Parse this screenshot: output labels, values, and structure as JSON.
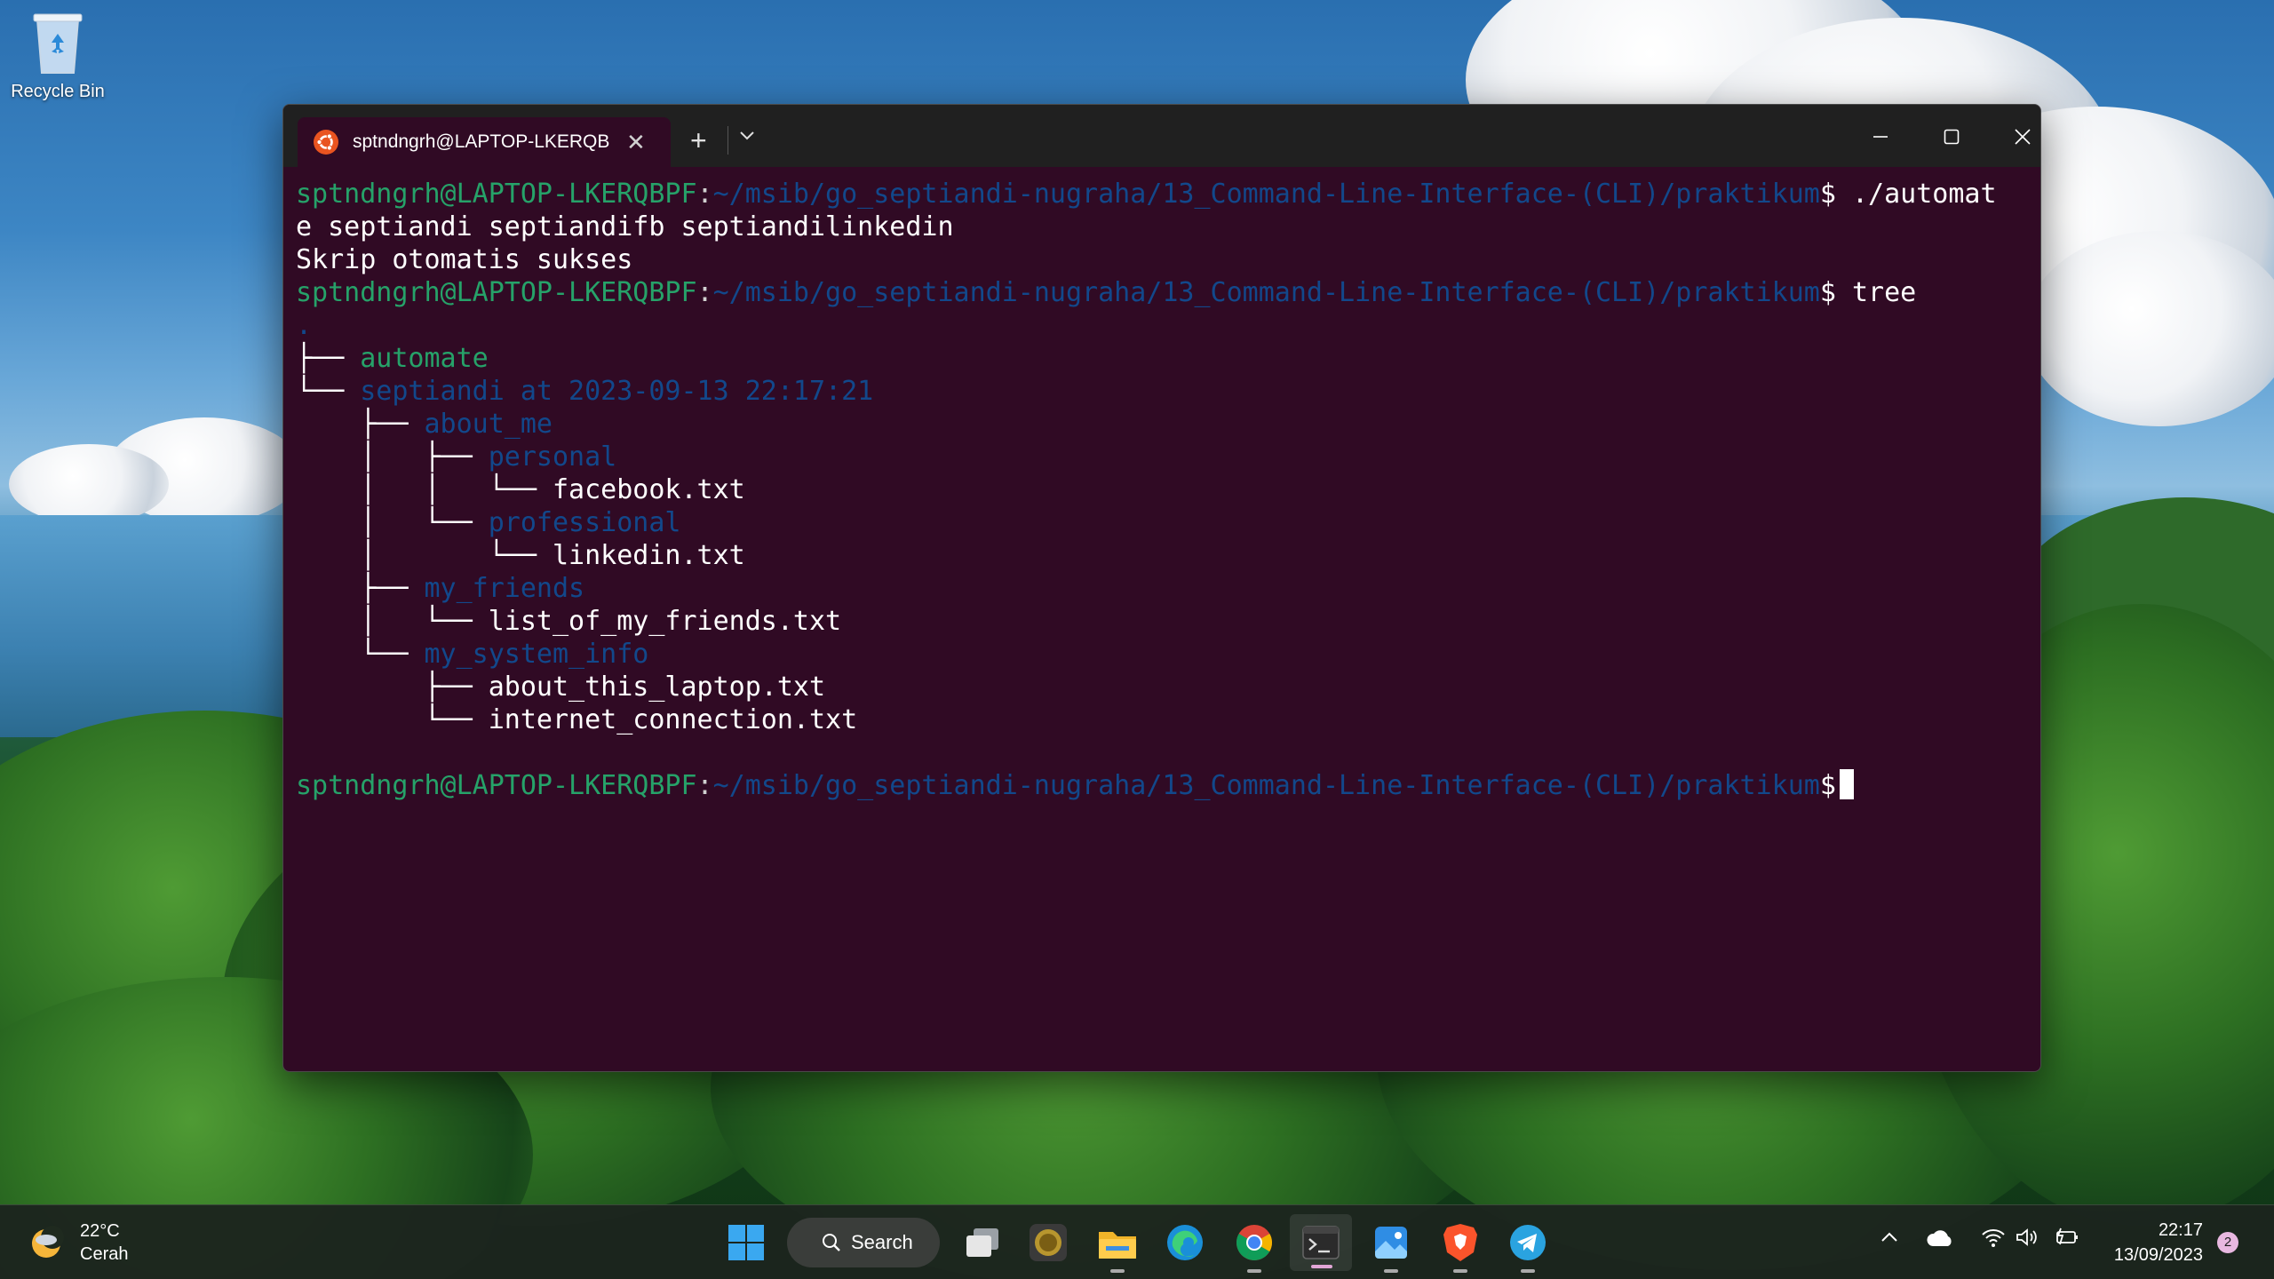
{
  "desktop": {
    "recycle_bin_label": "Recycle Bin"
  },
  "terminal": {
    "tab_title": "sptndngrh@LAPTOP-LKERQBPF: ~",
    "prompt_user": "sptndngrh@LAPTOP-LKERQBPF",
    "prompt_colon": ":",
    "prompt_path": "~/msib/go_septiandi-nugraha/13_Command-Line-Interface-(CLI)/praktikum",
    "prompt_dollar": "$",
    "cmd1_part1": " ./automat",
    "cmd1_part2": "e septiandi septiandifb septiandilinkedin",
    "output1": "Skrip otomatis sukses",
    "cmd2": " tree",
    "tree": {
      "root": ".",
      "l1_prefix": "├── ",
      "l1_name": "automate",
      "l2_prefix": "└── ",
      "l2_name": "septiandi at 2023-09-13 22:17:21",
      "l3_prefix": "    ├── ",
      "l3_name": "about_me",
      "l4_prefix": "    │   ├── ",
      "l4_name": "personal",
      "l5_prefix": "    │   │   └── ",
      "l5_name": "facebook.txt",
      "l6_prefix": "    │   └── ",
      "l6_name": "professional",
      "l7_prefix": "    │       └── ",
      "l7_name": "linkedin.txt",
      "l8_prefix": "    ├── ",
      "l8_name": "my_friends",
      "l9_prefix": "    │   └── ",
      "l9_name": "list_of_my_friends.txt",
      "l10_prefix": "    └── ",
      "l10_name": "my_system_info",
      "l11_prefix": "        ├── ",
      "l11_name": "about_this_laptop.txt",
      "l12_prefix": "        └── ",
      "l12_name": "internet_connection.txt"
    }
  },
  "taskbar": {
    "weather_temp": "22°C",
    "weather_cond": "Cerah",
    "search_label": "Search",
    "clock_time": "22:17",
    "clock_date": "13/09/2023",
    "notification_count": "2"
  }
}
